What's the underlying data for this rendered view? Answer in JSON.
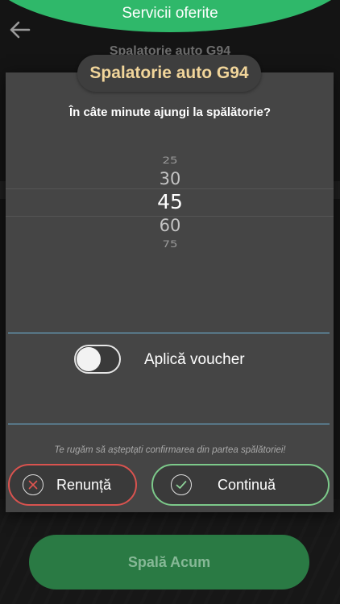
{
  "header": {
    "title": "Servicii oferite"
  },
  "background": {
    "shop_title": "Spalatorie auto G94",
    "action_button": "Spală Acum"
  },
  "modal": {
    "title": "Spalatorie auto G94",
    "question": "În câte minute ajungi la spălătorie?",
    "picker": {
      "options": [
        "25",
        "30",
        "45",
        "60",
        "75"
      ],
      "selected": "45"
    },
    "voucher": {
      "label": "Aplică voucher",
      "enabled": false
    },
    "notice": "Te rugăm să aștepta̦ti confirmarea din partea spălătoriei!",
    "buttons": {
      "cancel": "Renunță",
      "continue": "Continuă"
    }
  },
  "colors": {
    "header_green": "#2fb86a",
    "title_gold": "#f1d59a",
    "divider_blue": "#6fb7dc",
    "cancel_red": "#d9534f",
    "continue_green": "#7cc98a"
  }
}
